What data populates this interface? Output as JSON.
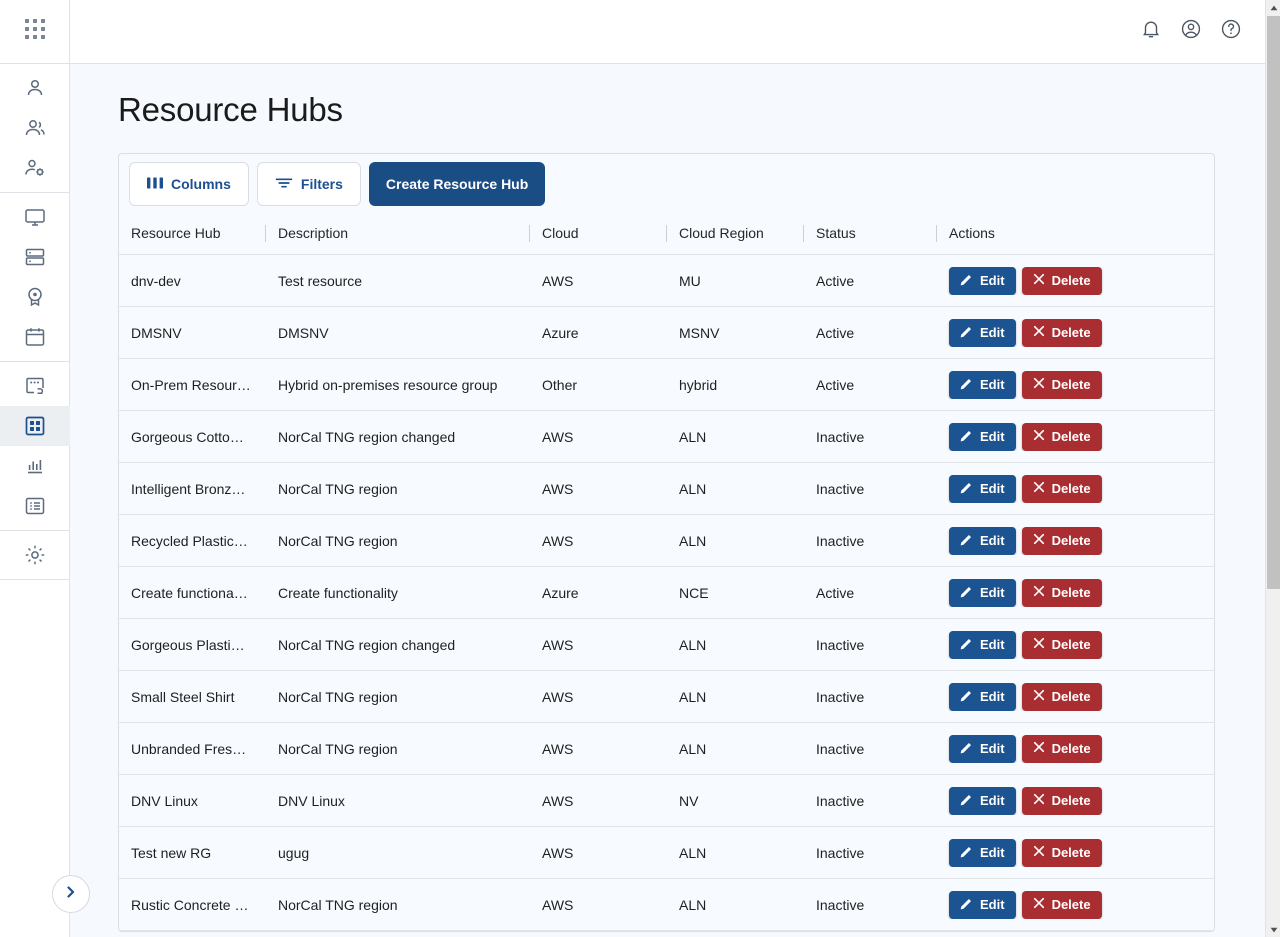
{
  "sidebar": {
    "logo_icon": "apps-grid-icon",
    "expand_button": {
      "icon": "chevron-right-icon",
      "label": "Expand navigation"
    },
    "groups": [
      {
        "items": [
          {
            "name": "sidebar-item-user",
            "icon": "person-icon",
            "active": false
          },
          {
            "name": "sidebar-item-users",
            "icon": "people-icon",
            "active": false
          },
          {
            "name": "sidebar-item-user-settings",
            "icon": "person-gear-icon",
            "active": false
          }
        ]
      },
      {
        "items": [
          {
            "name": "sidebar-item-desktops",
            "icon": "monitor-icon",
            "active": false
          },
          {
            "name": "sidebar-item-servers",
            "icon": "server-icon",
            "active": false
          },
          {
            "name": "sidebar-item-images",
            "icon": "badge-icon",
            "active": false
          },
          {
            "name": "sidebar-item-schedules",
            "icon": "calendar-icon",
            "active": false
          }
        ]
      },
      {
        "items": [
          {
            "name": "sidebar-item-connections",
            "icon": "card-link-icon",
            "active": false
          },
          {
            "name": "sidebar-item-resource-hubs",
            "icon": "grid-squares-icon",
            "active": true
          },
          {
            "name": "sidebar-item-reports",
            "icon": "bar-chart-icon",
            "active": false
          },
          {
            "name": "sidebar-item-logs",
            "icon": "list-icon",
            "active": false
          }
        ]
      },
      {
        "items": [
          {
            "name": "sidebar-item-settings",
            "icon": "gear-icon",
            "active": false
          }
        ]
      }
    ]
  },
  "topbar": {
    "icons": [
      {
        "name": "notifications-icon",
        "label": "Notifications"
      },
      {
        "name": "account-circle-icon",
        "label": "Account"
      },
      {
        "name": "help-circle-icon",
        "label": "Help"
      }
    ]
  },
  "page": {
    "title": "Resource Hubs"
  },
  "toolbar": {
    "columns_label": "Columns",
    "columns_icon": "columns-icon",
    "filters_label": "Filters",
    "filters_icon": "filter-icon",
    "create_label": "Create Resource Hub"
  },
  "table": {
    "columns": [
      {
        "key": "hub",
        "label": "Resource Hub"
      },
      {
        "key": "desc",
        "label": "Description"
      },
      {
        "key": "cloud",
        "label": "Cloud"
      },
      {
        "key": "region",
        "label": "Cloud Region"
      },
      {
        "key": "status",
        "label": "Status"
      },
      {
        "key": "actions",
        "label": "Actions"
      }
    ],
    "row_actions": {
      "edit_label": "Edit",
      "edit_icon": "pencil-icon",
      "delete_label": "Delete",
      "delete_icon": "close-x-icon"
    },
    "rows": [
      {
        "hub": "dnv-dev",
        "desc": "Test resource",
        "cloud": "AWS",
        "region": "MU",
        "status": "Active"
      },
      {
        "hub": "DMSNV",
        "desc": "DMSNV",
        "cloud": "Azure",
        "region": "MSNV",
        "status": "Active"
      },
      {
        "hub": "On-Prem Resour…",
        "desc": "Hybrid on-premises resource group",
        "cloud": "Other",
        "region": "hybrid",
        "status": "Active"
      },
      {
        "hub": "Gorgeous Cotto…",
        "desc": "NorCal TNG region changed",
        "cloud": "AWS",
        "region": "ALN",
        "status": "Inactive"
      },
      {
        "hub": "Intelligent Bronz…",
        "desc": "NorCal TNG region",
        "cloud": "AWS",
        "region": "ALN",
        "status": "Inactive"
      },
      {
        "hub": "Recycled Plastic…",
        "desc": "NorCal TNG region",
        "cloud": "AWS",
        "region": "ALN",
        "status": "Inactive"
      },
      {
        "hub": "Create functiona…",
        "desc": "Create functionality",
        "cloud": "Azure",
        "region": "NCE",
        "status": "Active"
      },
      {
        "hub": "Gorgeous Plasti…",
        "desc": "NorCal TNG region changed",
        "cloud": "AWS",
        "region": "ALN",
        "status": "Inactive"
      },
      {
        "hub": "Small Steel Shirt",
        "desc": "NorCal TNG region",
        "cloud": "AWS",
        "region": "ALN",
        "status": "Inactive"
      },
      {
        "hub": "Unbranded Fres…",
        "desc": "NorCal TNG region",
        "cloud": "AWS",
        "region": "ALN",
        "status": "Inactive"
      },
      {
        "hub": "DNV Linux",
        "desc": "DNV Linux",
        "cloud": "AWS",
        "region": "NV",
        "status": "Inactive"
      },
      {
        "hub": "Test new RG",
        "desc": "ugug",
        "cloud": "AWS",
        "region": "ALN",
        "status": "Inactive"
      },
      {
        "hub": "Rustic Concrete …",
        "desc": "NorCal TNG region",
        "cloud": "AWS",
        "region": "ALN",
        "status": "Inactive"
      }
    ]
  },
  "colors": {
    "primary": "#1b4d85",
    "edit": "#1c5391",
    "delete": "#a82e32",
    "page_bg": "#f6fafe",
    "card_bg": "#f7fbff",
    "icon": "#5b6b7d"
  }
}
